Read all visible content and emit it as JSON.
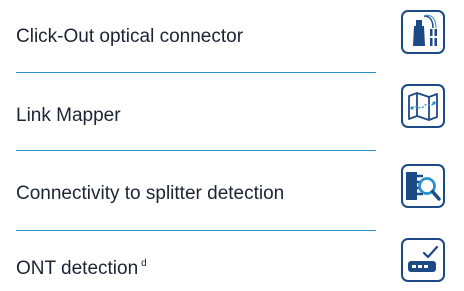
{
  "features": [
    {
      "label": "Click-Out optical connector",
      "footnote": "",
      "icon": "optical-connector-icon"
    },
    {
      "label": "Link Mapper",
      "footnote": "",
      "icon": "map-icon"
    },
    {
      "label": "Connectivity to splitter detection",
      "footnote": "",
      "icon": "splitter-search-icon"
    },
    {
      "label": "ONT detection",
      "footnote": "d",
      "icon": "ont-check-icon"
    }
  ],
  "colors": {
    "icon_primary": "#1c4a85",
    "icon_accent": "#2b8fc9",
    "divider": "#2b8fc9",
    "text": "#1b2433"
  }
}
